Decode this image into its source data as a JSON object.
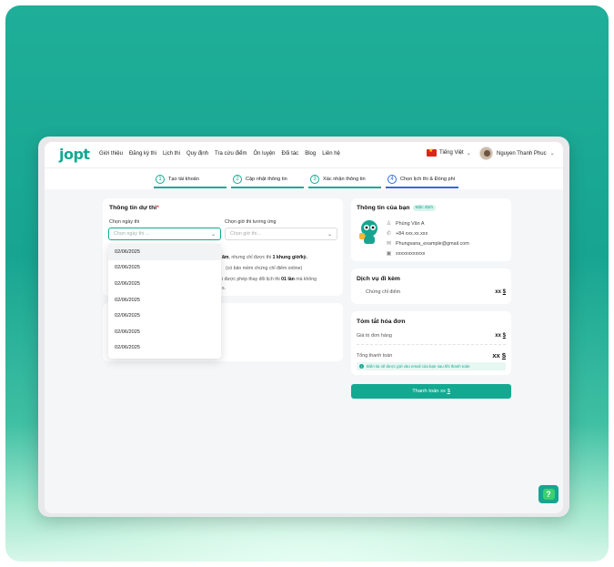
{
  "brand": {
    "logo": "jopt",
    "accent": "#13a991"
  },
  "nav": {
    "items": [
      "Giới thiệu",
      "Đăng ký thi",
      "Lịch thi",
      "Quy định",
      "Tra cứu điểm",
      "Ôn luyện",
      "Đối tác",
      "Blog",
      "Liên hệ"
    ],
    "language": "Tiếng Việt",
    "user_name": "Nguyen Thanh Phuc"
  },
  "steps": [
    {
      "num": "1",
      "label": "Tạo tài khoản"
    },
    {
      "num": "2",
      "label": "Cập nhật thông tin"
    },
    {
      "num": "3",
      "label": "Xác nhận thông tin"
    },
    {
      "num": "4",
      "label": "Chọn lịch thi & Đóng phí"
    }
  ],
  "exam_info": {
    "title": "Thông tin dự thi",
    "required_mark": "*",
    "date_label": "Chọn ngày thi",
    "date_placeholder": "Chọn ngày thi ...",
    "slot_label": "Chọn giờ thi tương ứng",
    "slot_placeholder": "Chọn giờ thi...",
    "notes": {
      "line1_bold_a": "ăm",
      "line1_text": ", nhưng chỉ được thi ",
      "line1_bold_b": "1 khung giờ/kỳ.",
      "line2_text": "(có bản mềm chứng chỉ điểm online)",
      "line3_text": "i được phép thay đổi lịch thi ",
      "line3_bold": "01 lần",
      "line3_tail": " mà không",
      "line4_text": "s."
    },
    "date_options": [
      "02/06/2025",
      "02/06/2025",
      "02/06/2025",
      "02/06/2025",
      "02/06/2025",
      "02/06/2025",
      "02/06/2025"
    ]
  },
  "your_info": {
    "title": "Thông tin của bạn",
    "badge": "Mặc định",
    "name": "Phùng Văn A",
    "phone": "+84 xxx.xx.xxx",
    "email": "Phungvana_example@gmail.com",
    "id": "xxxxxxxxxxxx"
  },
  "services": {
    "title": "Dịch vụ đi kèm",
    "item_label": "Chứng chỉ điểm",
    "item_price": "xx",
    "currency": "$"
  },
  "invoice": {
    "title": "Tóm tắt hóa đơn",
    "order_label": "Giá trị đơn hàng",
    "order_value": "xx",
    "total_label": "Tổng thanh toán",
    "total_value": "xx",
    "currency": "$",
    "notice": "Biên lai sẽ được gửi vào email của bạn sau khi thanh toán"
  },
  "pay_button": {
    "label": "Thanh toán xx",
    "currency": "$"
  },
  "help_button": {
    "symbol": "?"
  }
}
